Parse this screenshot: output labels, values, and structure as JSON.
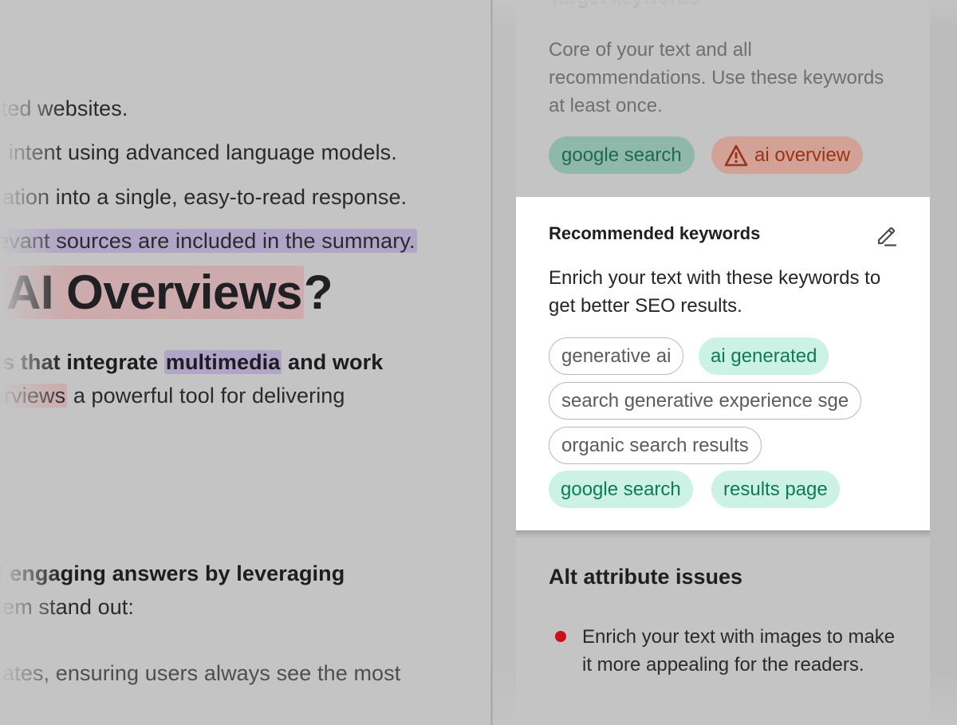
{
  "editor": {
    "lines": [
      "sted websites.",
      "h intent using advanced language models.",
      "nation into a single, easy-to-read response."
    ],
    "line4_text": "levant sources are included in the summary.",
    "heading_left": "AI Overviews",
    "heading_right": "?",
    "para1_pre": "es that integrate ",
    "para1_hl": "multimedia",
    "para1_post": " and work",
    "para1b_hl": "erviews",
    "para1b_post": " a powerful tool for delivering",
    "para2_line1": "d engaging answers by leveraging",
    "para2_line2": "hem stand out:",
    "para3_line1": "dates, ensuring users always see the most"
  },
  "target_keywords": {
    "title": "Target keywords",
    "description": "Core of your text and all recommendations. Use these keywords at least once.",
    "chips": [
      {
        "label": "google search",
        "status": "ok"
      },
      {
        "label": "ai overview",
        "status": "warning"
      }
    ]
  },
  "recommended_keywords": {
    "title": "Recommended keywords",
    "description": "Enrich your text with these keywords to get better SEO results.",
    "chips": [
      {
        "label": "generative ai",
        "style": "outline"
      },
      {
        "label": "ai generated",
        "style": "used"
      },
      {
        "label": "search generative experience sge",
        "style": "outline"
      },
      {
        "label": "organic search results",
        "style": "outline"
      },
      {
        "label": "google search",
        "style": "used"
      },
      {
        "label": "results page",
        "style": "used"
      }
    ]
  },
  "alt_attribute": {
    "title": "Alt attribute issues",
    "items": [
      "Enrich your text with images to make it more appealing for the readers."
    ]
  },
  "colors": {
    "used_chip_bg": "#ccf2e5",
    "used_chip_text": "#0f7a55",
    "warning_red": "#9b3217",
    "bullet_red": "#c9101c"
  },
  "icons": {
    "edit": "pencil-icon",
    "warning": "warning-triangle-icon"
  }
}
